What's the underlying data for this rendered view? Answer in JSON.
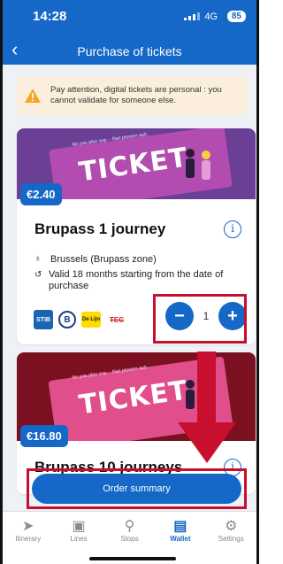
{
  "status_bar": {
    "time": "14:28",
    "network": "4G",
    "battery": "85"
  },
  "header": {
    "back_icon": "chevron-left-icon",
    "title": "Purchase of tickets"
  },
  "alert": {
    "icon": "warning-icon",
    "text": "Pay attention, digital tickets are personal : you cannot validate for someone else.",
    "color": "#f5a623"
  },
  "tickets": [
    {
      "price": "€2.40",
      "ticket_word": "TICKET",
      "tag_line": "Ne pas plier svp. - Niet plooien aub.",
      "name": "Brupass 1 journey",
      "zone": "Brussels (Brupass zone)",
      "validity": "Valid 18 months starting from the date of purchase",
      "operators": [
        "STIB",
        "B",
        "De Lijn",
        "TEC"
      ],
      "quantity": "1",
      "minus": "−",
      "plus": "+"
    },
    {
      "price": "€16.80",
      "ticket_word": "TICKET",
      "tag_line": "Ne pas plier svp. - Niet plooien aub.",
      "name": "Brupass 10 journeys"
    }
  ],
  "order_summary": "Order summary",
  "nav": {
    "items": [
      {
        "label": "Itinerary",
        "icon": "navigation-arrow-icon"
      },
      {
        "label": "Lines",
        "icon": "bus-icon"
      },
      {
        "label": "Stops",
        "icon": "stop-pin-icon"
      },
      {
        "label": "Wallet",
        "icon": "wallet-icon"
      },
      {
        "label": "Settings",
        "icon": "gear-icon"
      }
    ],
    "active": "Wallet"
  },
  "colors": {
    "brand": "#1568c7",
    "annotation": "#c8102e",
    "alert_bg": "#fbeedd"
  }
}
